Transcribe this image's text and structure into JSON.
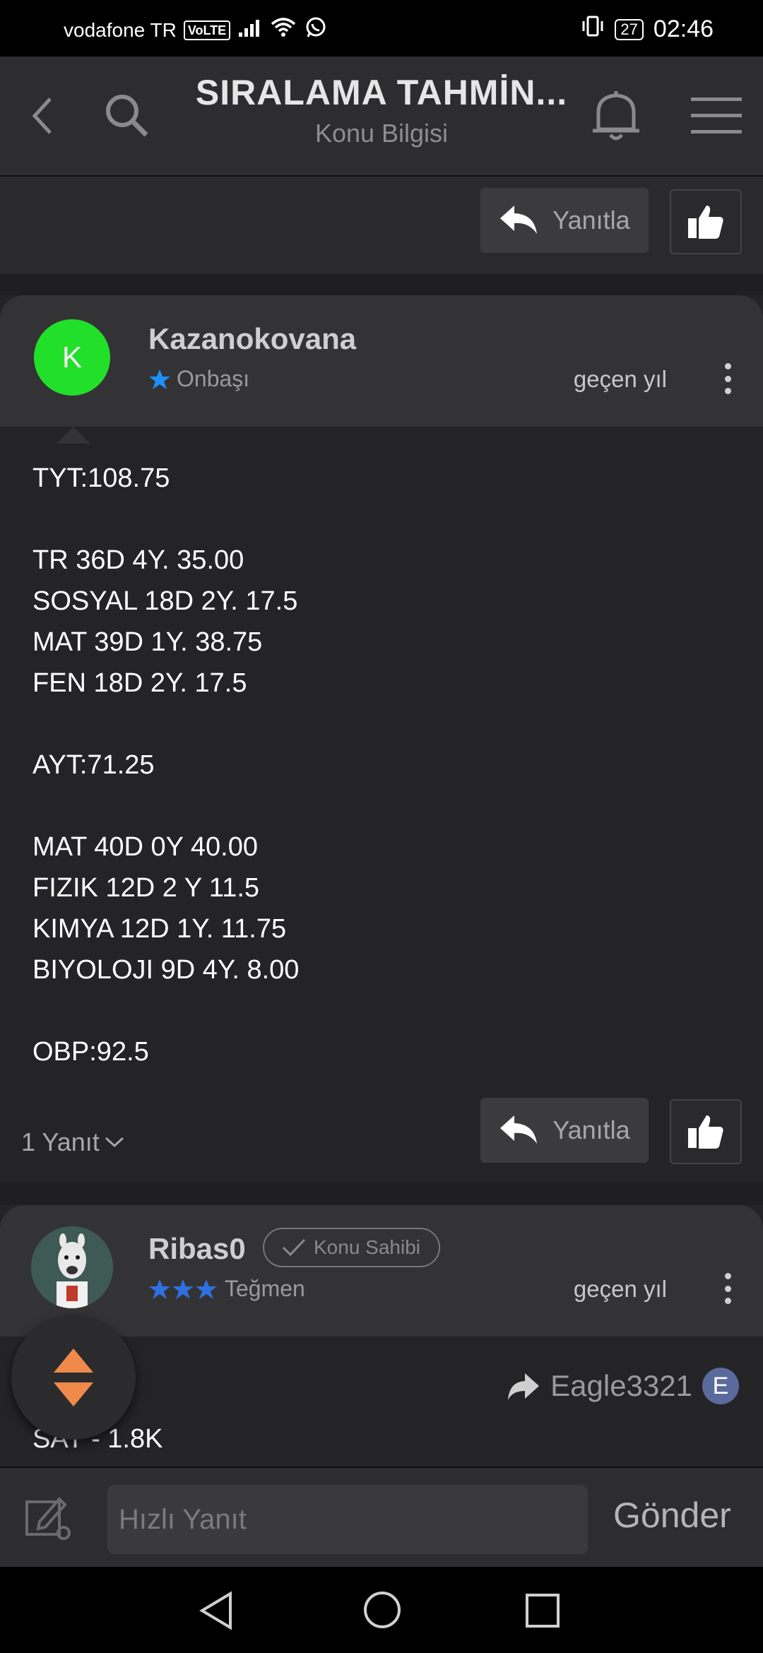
{
  "status_bar": {
    "carrier": "vodafone TR",
    "volte": "VoLTE",
    "battery": "27",
    "time": "02:46"
  },
  "header": {
    "title": "SIRALAMA TAHMİN...",
    "subtitle": "Konu Bilgisi"
  },
  "top_actions": {
    "reply_label": "Yanıtla"
  },
  "post1": {
    "avatar_letter": "K",
    "avatar_color": "#22e02a",
    "username": "Kazanokovana",
    "rank": "Onbaşı",
    "time": "geçen yıl",
    "lines": [
      "TYT:108.75",
      "",
      "TR 36D 4Y. 35.00",
      "SOSYAL 18D 2Y. 17.5",
      "MAT 39D 1Y. 38.75",
      "FEN 18D 2Y. 17.5",
      "",
      "AYT:71.25",
      "",
      "MAT 40D 0Y 40.00",
      "FIZIK 12D 2 Y 11.5",
      "KIMYA 12D 1Y. 11.75",
      "BIYOLOJI 9D 4Y. 8.00",
      "",
      "OBP:92.5"
    ],
    "replies_label": "1 Yanıt",
    "reply_label": "Yanıtla"
  },
  "post2": {
    "username": "Ribas0",
    "owner_badge": "Konu Sahibi",
    "rank": "Teğmen",
    "time": "geçen yıl",
    "quoted_user": "Eagle3321",
    "quoted_avatar_letter": "E",
    "first_line": "SAY - 1.8K"
  },
  "composer": {
    "placeholder": "Hızlı Yanıt",
    "send_label": "Gönder"
  },
  "colors": {
    "star_blue": "#1e90ff",
    "fab_orange": "#f08a4b"
  }
}
